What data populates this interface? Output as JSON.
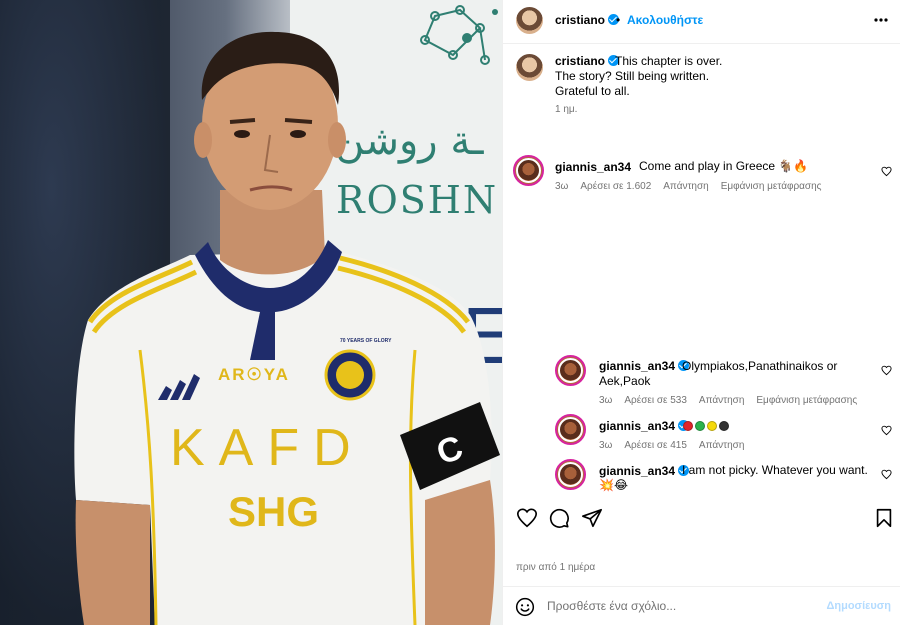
{
  "post": {
    "author": "cristiano",
    "follow_label": "Ακολουθήστε",
    "separator": "•",
    "caption_lines": [
      "This chapter is over.",
      "The story? Still being written.",
      "Grateful to all."
    ],
    "caption_age": "1 ημ.",
    "timestamp": "πριν από 1 ημέρα"
  },
  "photo": {
    "board_arabic": "ـة روشن",
    "board_latin": "ROSHN C",
    "board_partial": "E",
    "jersey_sponsor": "KAFD",
    "jersey_sponsor2": "SHG",
    "jersey_brand": "AR☉YA",
    "badge_text": "70 YEARS OF GLORY"
  },
  "comments": [
    {
      "user": "giannis_an34",
      "text": "Come and play in Greece 🐐🔥",
      "age": "3ω",
      "likes": "Αρέσει σε 1.602",
      "reply": "Απάντηση",
      "translate": "Εμφάνιση μετάφρασης"
    },
    {
      "user": "giannis_an34",
      "text_line1": "Olympiakos,Panathinaikos or",
      "text_line2": "Aek,Paok",
      "age": "3ω",
      "likes": "Αρέσει σε 533",
      "reply": "Απάντηση",
      "translate": "Εμφάνιση μετάφρασης"
    },
    {
      "user": "giannis_an34",
      "emoji_colors": [
        "#e0252b",
        "#2bb24c",
        "#f5d90a",
        "#333333"
      ],
      "age": "3ω",
      "likes": "Αρέσει σε 415",
      "reply": "Απάντηση"
    },
    {
      "user": "giannis_an34",
      "text": "I am not picky. Whatever you want.",
      "text_line2": "💥😂"
    }
  ],
  "footer": {
    "placeholder": "Προσθέστε ένα σχόλιο...",
    "post_label": "Δημοσίευση"
  },
  "colors": {
    "accent": "#0095f6",
    "muted": "#737373"
  }
}
